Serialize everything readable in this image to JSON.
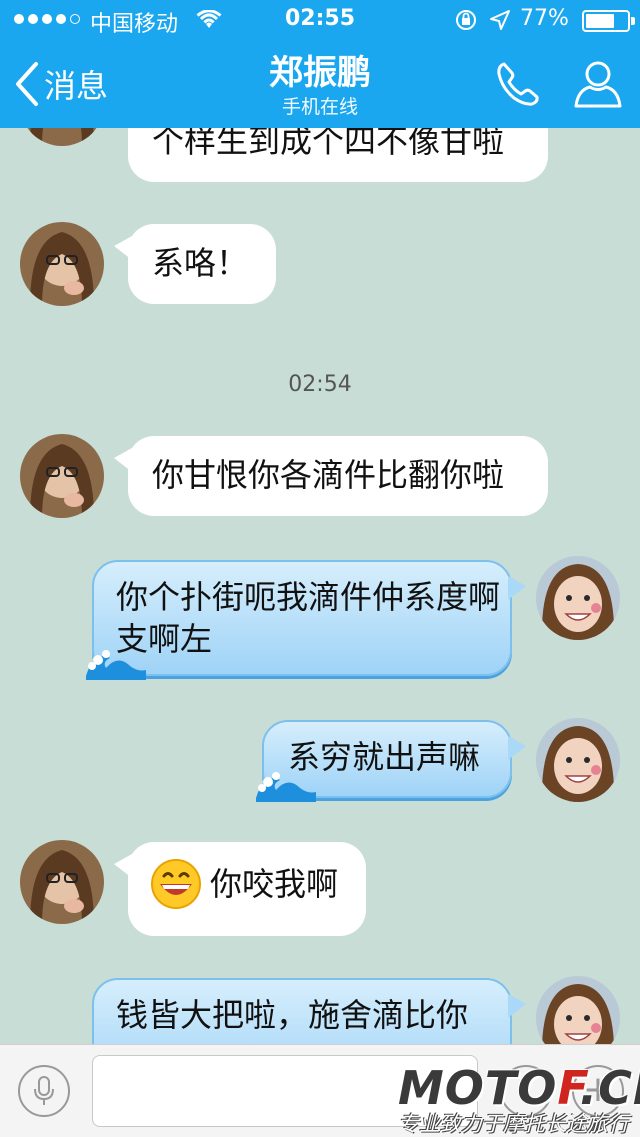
{
  "status_bar": {
    "carrier": "中国移动",
    "time": "02:55",
    "battery_percent": "77%",
    "battery_level": 0.77
  },
  "nav": {
    "back_label": "消息",
    "title": "郑振鹏",
    "subtitle": "手机在线"
  },
  "messages": [
    {
      "direction": "in",
      "text": "个样生到成个四不像甘啦"
    },
    {
      "direction": "in",
      "text": "系咯！"
    },
    {
      "direction": "in",
      "text": "你甘恨你各滴件比翻你啦"
    },
    {
      "direction": "out",
      "text": "你个扑街呃我滴件仲系度啊支啊左"
    },
    {
      "direction": "out",
      "text": "系穷就出声嘛"
    },
    {
      "direction": "in",
      "text": "你咬我啊",
      "emoji": "grinning-face"
    },
    {
      "direction": "out",
      "text": "钱皆大把啦，施舍滴比你"
    }
  ],
  "timestamp": "02:54",
  "input": {
    "placeholder": "",
    "value": ""
  },
  "watermark": {
    "brand_part1": "MOTO",
    "brand_part2": "F",
    "brand_part3": ".CN",
    "tagline": "专业致力于摩托长途旅行"
  },
  "icons": {
    "signal": "signal-dots-icon",
    "wifi": "wifi-icon",
    "lock": "orientation-lock-icon",
    "location": "location-arrow-icon",
    "back": "chevron-left-icon",
    "phone": "phone-icon",
    "profile": "person-icon",
    "mic": "microphone-icon",
    "emoji": "emoji-icon",
    "plus": "plus-icon"
  },
  "colors": {
    "nav_bar": "#1aa7f0",
    "chat_background": "#c7ddd6",
    "incoming_bubble": "#ffffff",
    "outgoing_bubble": "#a9d8f8"
  }
}
